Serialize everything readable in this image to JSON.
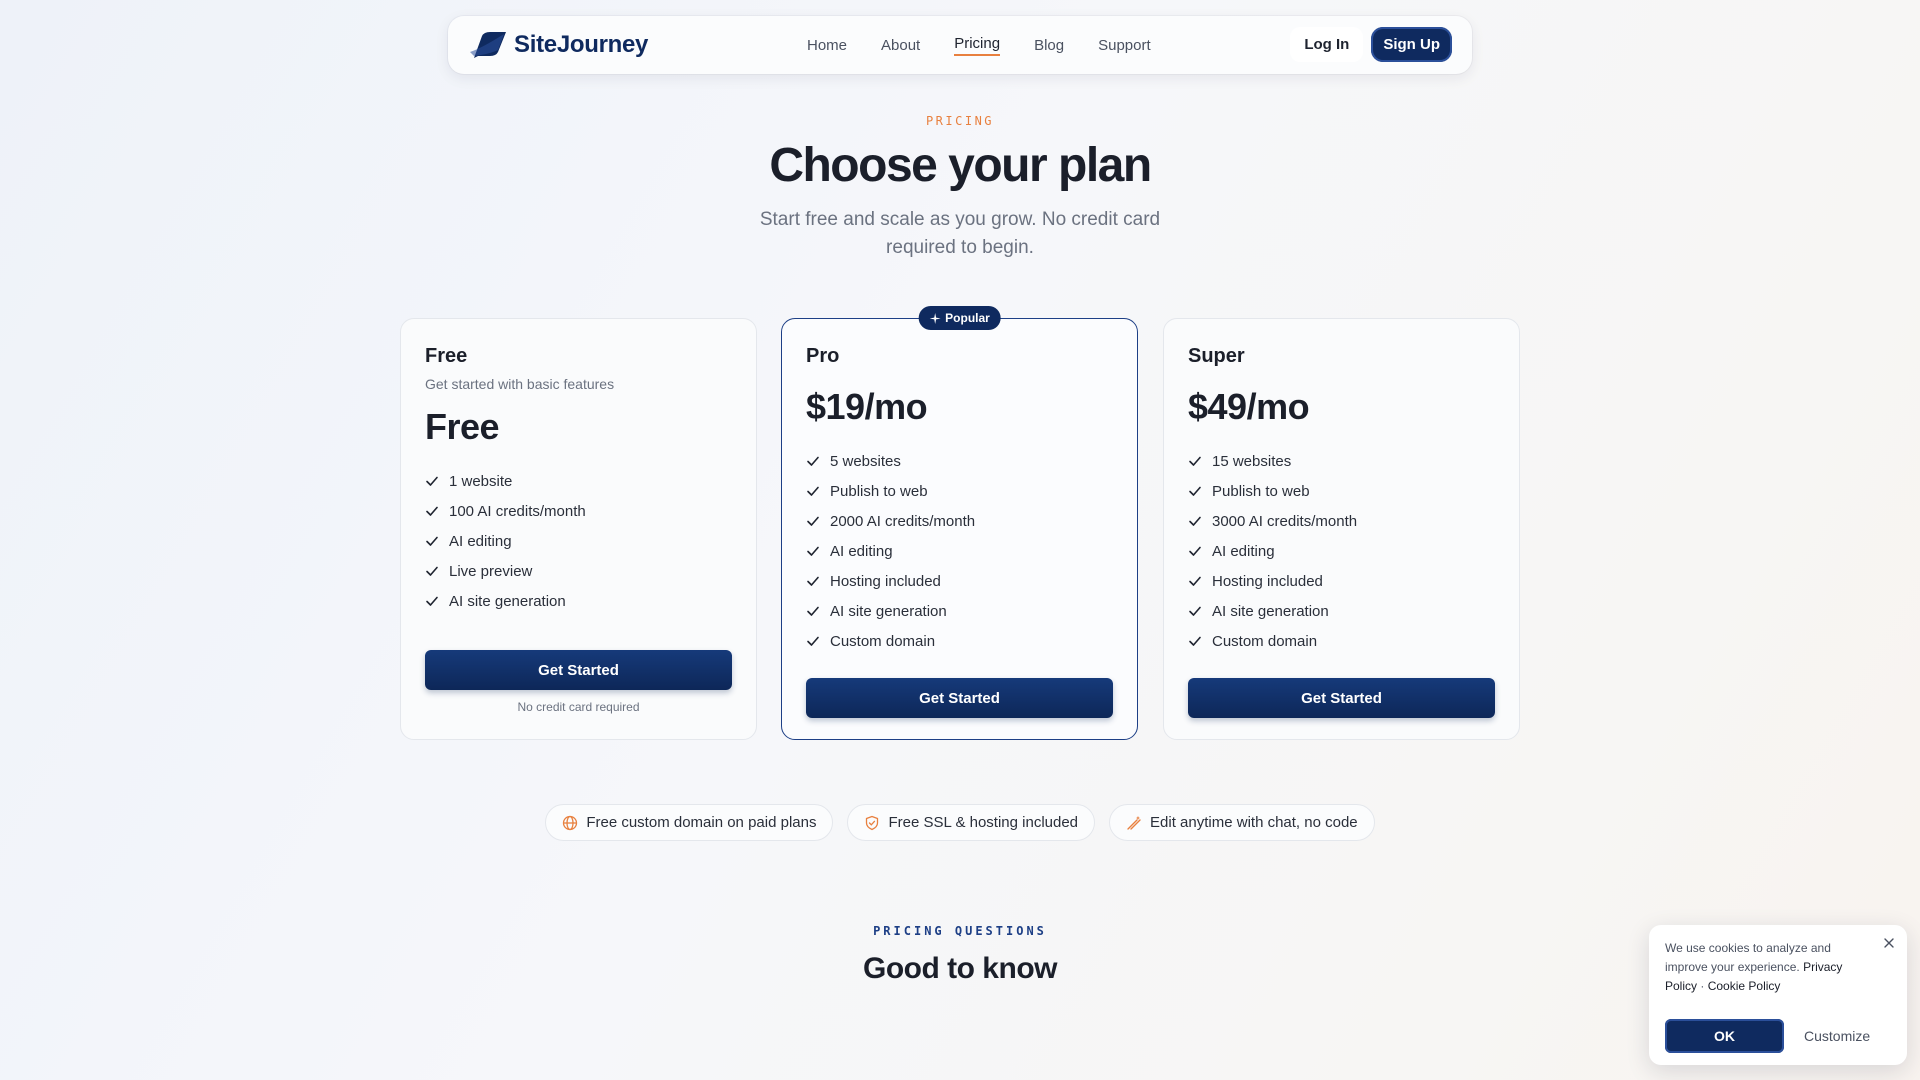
{
  "nav": {
    "brand": "SiteJourney",
    "links": [
      {
        "label": "Home",
        "active": false
      },
      {
        "label": "About",
        "active": false
      },
      {
        "label": "Pricing",
        "active": true
      },
      {
        "label": "Blog",
        "active": false
      },
      {
        "label": "Support",
        "active": false
      }
    ],
    "login_label": "Log In",
    "signup_label": "Sign Up"
  },
  "hero": {
    "eyebrow": "PRICING",
    "title": "Choose your plan",
    "subtitle": "Start free and scale as you grow. No credit card required to begin."
  },
  "plans": [
    {
      "name": "Free",
      "description": "Get started with basic features",
      "price": "Free",
      "features": [
        "1 website",
        "100 AI credits/month",
        "AI editing",
        "Live preview",
        "AI site generation"
      ],
      "cta_label": "Get Started",
      "note": "No credit card required"
    },
    {
      "name": "Pro",
      "badge": "Popular",
      "price": "$19/mo",
      "features": [
        "5 websites",
        "Publish to web",
        "2000 AI credits/month",
        "AI editing",
        "Hosting included",
        "AI site generation",
        "Custom domain"
      ],
      "cta_label": "Get Started"
    },
    {
      "name": "Super",
      "price": "$49/mo",
      "features": [
        "15 websites",
        "Publish to web",
        "3000 AI credits/month",
        "AI editing",
        "Hosting included",
        "AI site generation",
        "Custom domain"
      ],
      "cta_label": "Get Started"
    }
  ],
  "highlights": [
    {
      "icon": "globe-icon",
      "label": "Free custom domain on paid plans"
    },
    {
      "icon": "shield-icon",
      "label": "Free SSL & hosting included"
    },
    {
      "icon": "magic-wand-icon",
      "label": "Edit anytime with chat, no code"
    }
  ],
  "faq": {
    "eyebrow": "PRICING QUESTIONS",
    "title": "Good to know"
  },
  "cookie": {
    "text": "We use cookies to analyze and improve your experience.",
    "privacy_link": "Privacy Policy",
    "separator": "·",
    "cookie_link": "Cookie Policy",
    "ok_label": "OK",
    "customize_label": "Customize"
  },
  "colors": {
    "brand_navy": "#0f2a5f",
    "accent_orange": "#e8803f"
  }
}
